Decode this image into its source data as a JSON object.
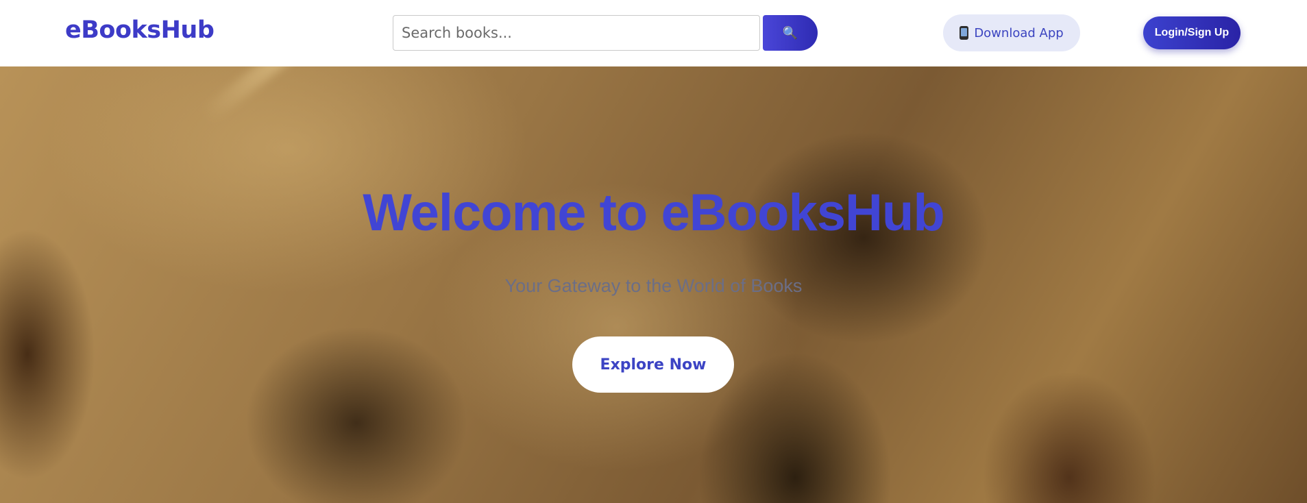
{
  "brand": {
    "name": "eBooksHub"
  },
  "search": {
    "placeholder": "Search books...",
    "button_icon": "search-icon"
  },
  "header": {
    "download_label": "Download App",
    "download_icon": "phone-icon",
    "login_label": "Login/Sign Up"
  },
  "hero": {
    "title": "Welcome to eBooksHub",
    "subtitle": "Your Gateway to the World of Books",
    "cta_label": "Explore Now"
  },
  "colors": {
    "brand": "#3d3bc7",
    "button_gradient_start": "#3c42cf",
    "button_gradient_end": "#2a23a6",
    "download_bg": "#e6e9f8"
  }
}
